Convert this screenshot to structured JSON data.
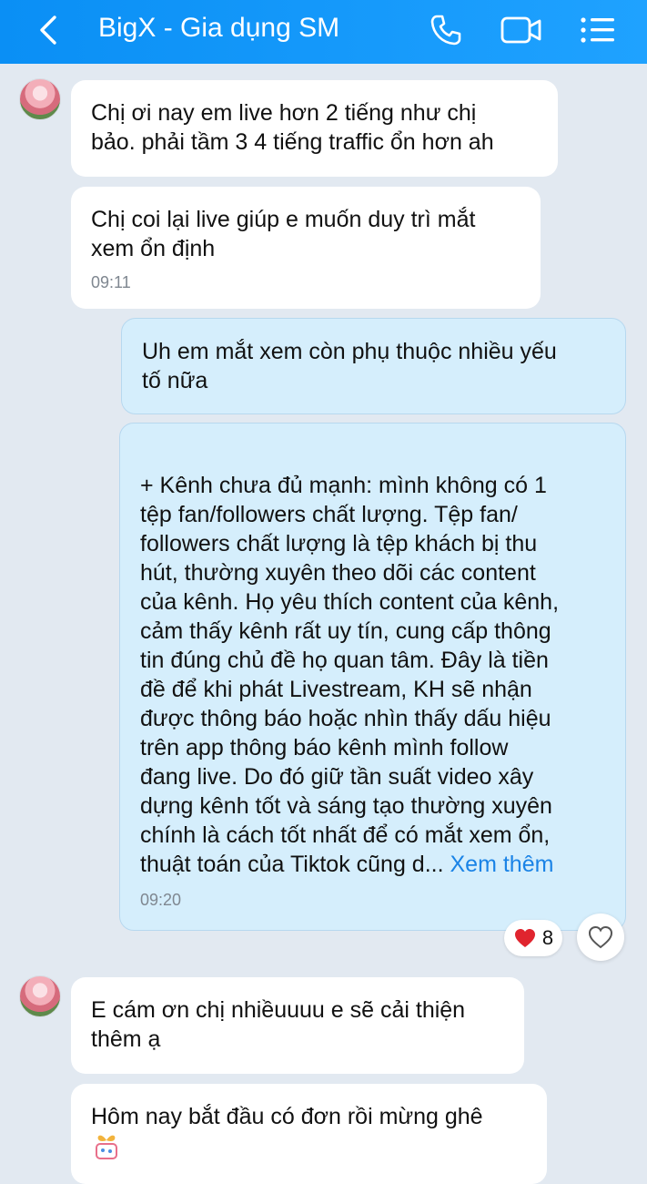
{
  "header": {
    "title": "BigX - Gia dụng SM",
    "icons": [
      "back-icon",
      "phone-icon",
      "video-call-icon",
      "menu-icon"
    ]
  },
  "messages": [
    {
      "text": "Chị ơi nay em live hơn 2 tiếng như chị\nbảo. phải tầm 3 4 tiếng traffic ổn hơn ah"
    },
    {
      "text": "Chị coi lại live giúp e muốn duy trì mắt\nxem ổn định",
      "time": "09:11"
    },
    {
      "text": "Uh em mắt xem còn phụ thuộc nhiều yếu\ntố nữa"
    },
    {
      "text": "+ Kênh chưa đủ mạnh: mình không có 1\ntệp fan/followers chất lượng. Tệp fan/\nfollowers chất lượng là tệp khách bị thu\nhút, thường xuyên theo dõi các content\ncủa kênh. Họ yêu thích content của kênh,\ncảm thấy kênh rất uy tín, cung cấp thông\ntin đúng chủ đề họ quan tâm. Đây là tiền\nđề để khi phát Livestream, KH sẽ nhận\nđược thông báo hoặc nhìn thấy dấu hiệu\ntrên app thông báo kênh mình follow\nđang live. Do đó giữ tần suất video xây\ndựng kênh tốt và sáng tạo thường xuyên\nchính là cách tốt nhất để có mắt xem ổn,\nthuật toán của Tiktok cũng d... ",
      "more": "Xem thêm",
      "time": "09:20"
    },
    {
      "text": "E cám ơn chị nhiềuuuu e sẽ cải thiện\nthêm ạ"
    },
    {
      "text": "Hôm nay bắt đầu có đơn rồi mừng ghê"
    }
  ],
  "reaction": {
    "count": "8",
    "icon": "heart-icon"
  },
  "colors": {
    "header": "#1a9bfd",
    "incoming": "#ffffff",
    "outgoing": "#d5eefc",
    "link": "#1a83e6"
  }
}
